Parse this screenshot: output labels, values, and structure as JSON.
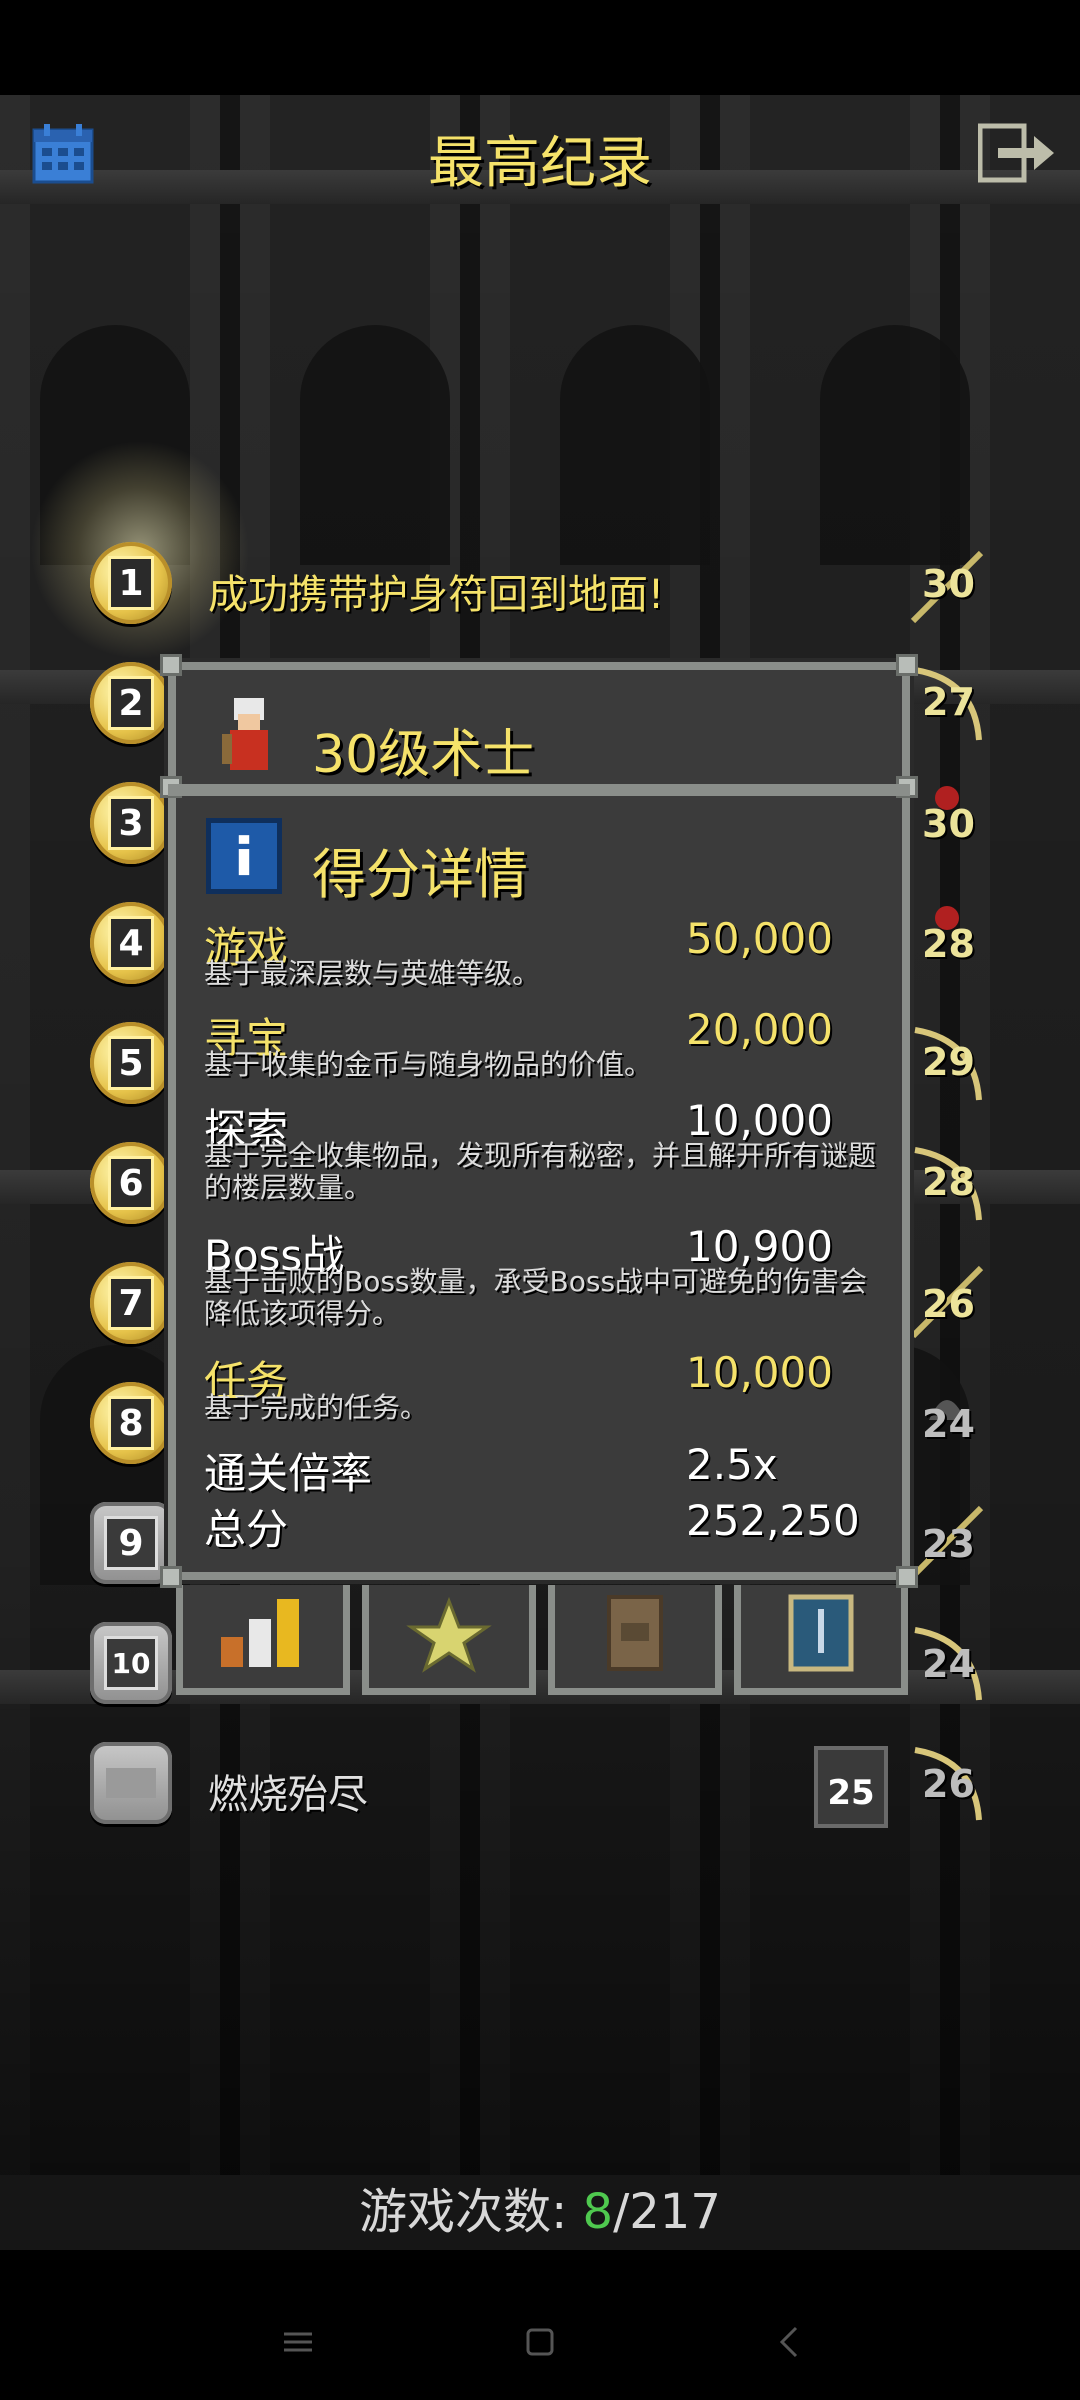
{
  "header": {
    "title": "最高纪录",
    "calendar_icon": "calendar-icon",
    "exit_icon": "exit-icon"
  },
  "colors": {
    "title_yellow": "#f5e26a",
    "count_green": "#4fc94f",
    "panel_bg": "#3b3b3b",
    "panel_border": "#8a8e8a"
  },
  "rankings": [
    {
      "rank": "1",
      "text": "成功携带护身符回到地面!",
      "level": "30"
    },
    {
      "rank": "2",
      "level": "27"
    },
    {
      "rank": "3",
      "level": "30"
    },
    {
      "rank": "4",
      "level": "28"
    },
    {
      "rank": "5",
      "level": "29"
    },
    {
      "rank": "6",
      "level": "28"
    },
    {
      "rank": "7",
      "level": "26"
    },
    {
      "rank": "8",
      "level": "24"
    },
    {
      "rank": "9",
      "level": "23"
    },
    {
      "rank": "10",
      "level": "24"
    },
    {
      "rank": "",
      "text": "燃烧殆尽",
      "depth": "25",
      "level": "26"
    }
  ],
  "score_panel": {
    "hero_title": "30级术士",
    "section_title": "得分详情",
    "items": [
      {
        "label": "游戏",
        "value": "50,000",
        "desc": "基于最深层数与英雄等级。"
      },
      {
        "label": "寻宝",
        "value": "20,000",
        "desc": "基于收集的金币与随身物品的价值。"
      },
      {
        "label": "探索",
        "value": "10,000",
        "desc": "基于完全收集物品，发现所有秘密，并且解开所有谜题的楼层数量。"
      },
      {
        "label": "Boss战",
        "value": "10,900",
        "desc": "基于击败的Boss数量，承受Boss战中可避免的伤害会降低该项得分。"
      },
      {
        "label": "任务",
        "value": "10,000",
        "desc": "基于完成的任务。"
      }
    ],
    "multiplier_label": "通关倍率",
    "multiplier_value": "2.5x",
    "total_label": "总分",
    "total_value": "252,250"
  },
  "tabs": [
    "stats-tab",
    "badges-tab",
    "items-tab",
    "journal-tab"
  ],
  "play_count": {
    "label": "游戏次数: ",
    "current": "8",
    "total": "/217"
  }
}
